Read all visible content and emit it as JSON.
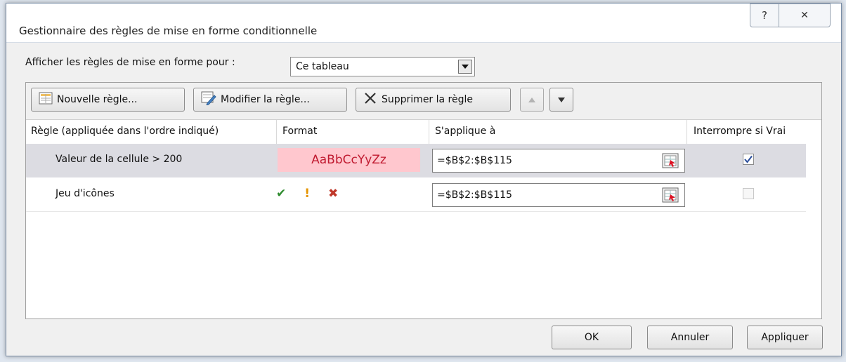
{
  "window": {
    "title": "Gestionnaire des règles de mise en forme conditionnelle",
    "help_glyph": "?",
    "close_glyph": "✕"
  },
  "show_rules": {
    "label": "Afficher les règles de mise en forme pour :",
    "selected": "Ce tableau"
  },
  "toolbar": {
    "new_rule": "Nouvelle règle...",
    "edit_rule": "Modifier la règle...",
    "delete_rule": "Supprimer la règle"
  },
  "table": {
    "columns": [
      "Règle (appliquée dans l'ordre indiqué)",
      "Format",
      "S'applique à",
      "Interrompre si Vrai"
    ],
    "rows": [
      {
        "rule": "Valeur de la cellule > 200",
        "format_preview": "AaBbCcYyZz",
        "applies_to": "=$B$2:$B$115",
        "stop_if_true": true,
        "selected": true
      },
      {
        "rule": "Jeu d'icônes",
        "icons": [
          "✔",
          "!",
          "✖"
        ],
        "icon_colors": [
          "#2e8b2e",
          "#e59400",
          "#c0392b"
        ],
        "applies_to": "=$B$2:$B$115",
        "stop_if_true": false,
        "selected": false
      }
    ]
  },
  "buttons": {
    "ok": "OK",
    "cancel": "Annuler",
    "apply": "Appliquer"
  }
}
